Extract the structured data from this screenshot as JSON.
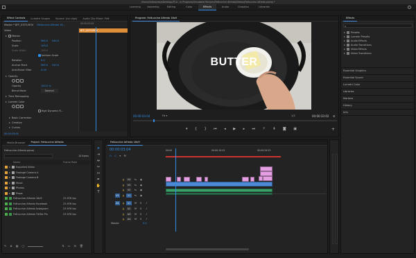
{
  "title_bar": {
    "text": "/Users/lindsayrose/Desktop/TCA - In Progress/Unsubbed Recipes/Fettuccine Alfredo/Videos/Fettuccine Alfredo.prproj *"
  },
  "workspaces": [
    {
      "label": "Learning",
      "active": false
    },
    {
      "label": "Assembly",
      "active": false
    },
    {
      "label": "Editing",
      "active": false
    },
    {
      "label": "Color",
      "active": false
    },
    {
      "label": "Effects",
      "active": true
    },
    {
      "label": "Audio",
      "active": false
    },
    {
      "label": "Graphics",
      "active": false
    },
    {
      "label": "Libraries",
      "active": false
    }
  ],
  "effect_controls": {
    "tabs": [
      "Effect Controls",
      "Lumetri Scopes",
      "Source: (no clips)",
      "Audio Clip Mixer: Fett"
    ],
    "source_line": "Master * BFF_0375.MOV",
    "sequence_line": "Fettuccine Alfredo 16...",
    "time_ruler": "00:00:03:00",
    "clip_label": "BFF_0375.MOV",
    "sections": [
      "Video",
      "Motion",
      "Opacity",
      "Time Remapping",
      "Lumetri Color"
    ],
    "properties": [
      {
        "name": "Position",
        "value1": "960.0",
        "value2": "540.0"
      },
      {
        "name": "Scale",
        "value1": "100.0",
        "value2": ""
      },
      {
        "name": "Scale Width",
        "value1": "100.0",
        "value2": ""
      },
      {
        "name": "Uniform Scale",
        "value1": "",
        "value2": ""
      },
      {
        "name": "Rotation",
        "value1": "0.0",
        "value2": ""
      },
      {
        "name": "Anchor Point",
        "value1": "960.0",
        "value2": "540.0"
      },
      {
        "name": "Anti-flicker Filter",
        "value1": "0.00",
        "value2": ""
      },
      {
        "name": "Opacity",
        "value1": "100.0 %",
        "value2": ""
      },
      {
        "name": "Blend Mode",
        "value1": "Normal",
        "value2": ""
      },
      {
        "name": "High Dynamic R...",
        "value1": "",
        "value2": ""
      },
      {
        "name": "Basic Correction",
        "value1": "",
        "value2": ""
      },
      {
        "name": "Creative",
        "value1": "",
        "value2": ""
      },
      {
        "name": "Curves",
        "value1": "",
        "value2": ""
      }
    ],
    "timecode": "00:00:03:04"
  },
  "program_monitor": {
    "title": "Program: Fettuccine Alfredo 16x9",
    "overlay_text": "BUTTER",
    "timecode_left": "00:00:03:04",
    "fit_label": "Fit",
    "quality_label": "1/2",
    "timecode_right": "00:00:33:02"
  },
  "effects_panel": {
    "title": "Effects",
    "items": [
      "Presets",
      "Lumetri Presets",
      "Audio Effects",
      "Audio Transitions",
      "Video Effects",
      "Video Transitions"
    ],
    "sections": [
      "Essential Graphics",
      "Essential Sound",
      "Lumetri Color",
      "Libraries",
      "Markers",
      "History",
      "Info"
    ]
  },
  "project_panel": {
    "tabs": [
      "Media Browser",
      "Project: Fettuccine Alfredo"
    ],
    "project_file": "Fettuccine Alfredo.prproj",
    "item_count": "10 Items",
    "col_name": "Name",
    "col_rate": "Frame Rate",
    "items": [
      {
        "name": "Exported Video",
        "rate": "",
        "color": "#e8a33a",
        "type": "folder"
      },
      {
        "name": "Footage Camera A",
        "rate": "",
        "color": "#e8a33a",
        "type": "folder"
      },
      {
        "name": "Footage Camera B",
        "rate": "",
        "color": "#e8a33a",
        "type": "folder"
      },
      {
        "name": "Music",
        "rate": "",
        "color": "#e8a33a",
        "type": "folder"
      },
      {
        "name": "Photos",
        "rate": "",
        "color": "#e8a33a",
        "type": "folder"
      },
      {
        "name": "Props",
        "rate": "",
        "color": "#e8a33a",
        "type": "folder"
      },
      {
        "name": "Fettuccine Alfredo 16x9",
        "rate": "23.976 fps",
        "color": "#4cb04c",
        "type": "sequence"
      },
      {
        "name": "Fettuccine Alfredo Facebook",
        "rate": "23.976 fps",
        "color": "#4cb04c",
        "type": "sequence"
      },
      {
        "name": "Fettuccine Alfredo Instagram",
        "rate": "23.976 fps",
        "color": "#4cb04c",
        "type": "sequence"
      },
      {
        "name": "Fettuccine Alfredo TikTok Pin",
        "rate": "23.976 fps",
        "color": "#4cb04c",
        "type": "sequence"
      }
    ]
  },
  "timeline": {
    "tab": "Fettuccine Alfredo 16x9",
    "timecode": "00:00:03:04",
    "ruler_labels": [
      "00:00",
      "00:00:14:23",
      "00:00:29:23"
    ],
    "video_tracks": [
      "V4",
      "V3",
      "V2",
      "V1"
    ],
    "audio_tracks": [
      "A1",
      "A2",
      "A3",
      "A4"
    ],
    "master_label": "Master",
    "master_value": "0.0",
    "source_patch_v": "V1",
    "source_patch_a": "A1"
  },
  "colors": {
    "accent": "#2f8de8",
    "video_clip": "#e59ee2",
    "audio_clip": "#3aa06a",
    "timecode_blue": "#2f8de8"
  }
}
